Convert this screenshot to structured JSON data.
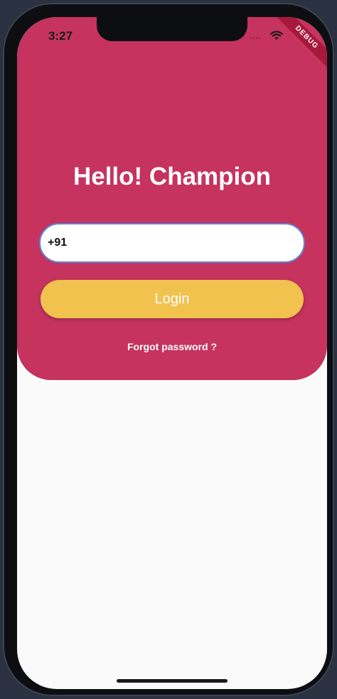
{
  "status_bar": {
    "time": "3:27",
    "signal": "••••",
    "wifi_icon": "wifi-icon"
  },
  "debug_ribbon": {
    "label": "DEBUG"
  },
  "login_card": {
    "title": "Hello! Champion",
    "phone_input": {
      "value": "+91",
      "placeholder": ""
    },
    "login_button_label": "Login",
    "forgot_password_label": "Forgot password ?"
  },
  "colors": {
    "card_background": "#c5335e",
    "login_button": "#f2c24f",
    "input_border": "#5b86d8",
    "screen_background": "#fafafa"
  }
}
